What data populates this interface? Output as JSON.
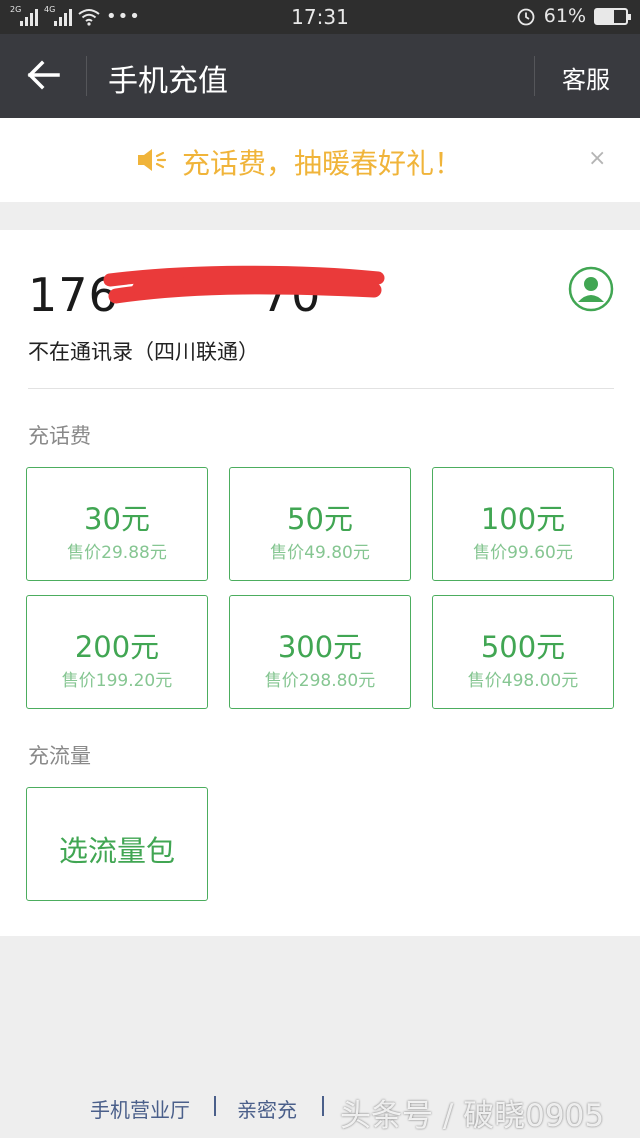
{
  "status_bar": {
    "time": "17:31",
    "battery_percent": "61%",
    "battery_level": 0.61,
    "network_tags": [
      "2G",
      "4G"
    ]
  },
  "nav": {
    "title": "手机充值",
    "service_label": "客服"
  },
  "notice": {
    "text": "充话费，抽暖春好礼！",
    "close": "×"
  },
  "account": {
    "phone_visible_start": "176",
    "phone_visible_end": "70",
    "contact_info": "不在通讯录（四川联通）"
  },
  "recharge": {
    "section_label": "充话费",
    "options": [
      {
        "amount": "30元",
        "price": "售价29.88元"
      },
      {
        "amount": "50元",
        "price": "售价49.80元"
      },
      {
        "amount": "100元",
        "price": "售价99.60元"
      },
      {
        "amount": "200元",
        "price": "售价199.20元"
      },
      {
        "amount": "300元",
        "price": "售价298.80元"
      },
      {
        "amount": "500元",
        "price": "售价498.00元"
      }
    ]
  },
  "data_plan": {
    "section_label": "充流量",
    "button_label": "选流量包"
  },
  "footer": {
    "links": [
      "手机营业厅",
      "亲密充"
    ]
  },
  "watermark": "头条号 / 破晓0905",
  "colors": {
    "accent": "#41a653",
    "notice": "#f0b43a",
    "nav_bg": "#393a3f"
  }
}
